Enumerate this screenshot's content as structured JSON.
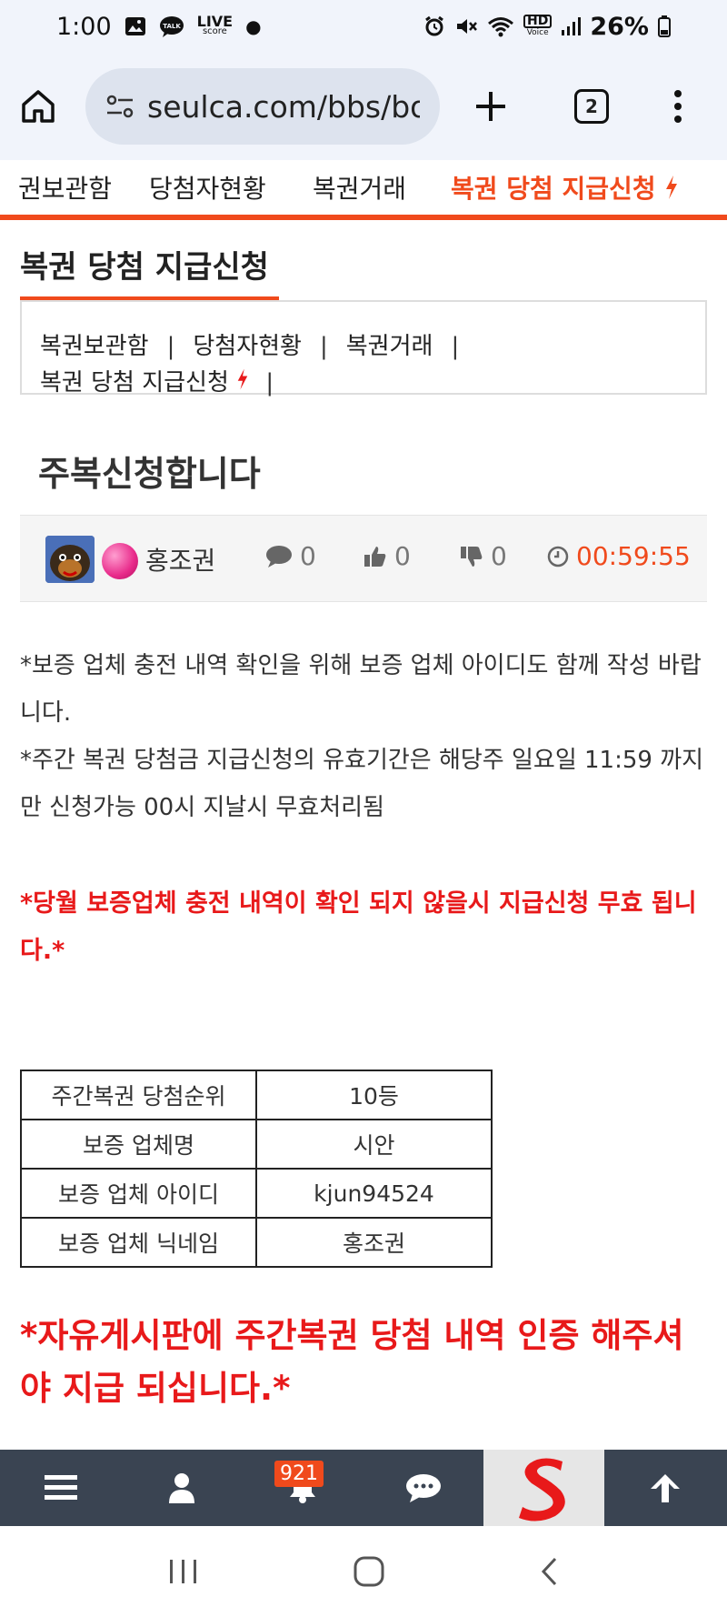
{
  "status_bar": {
    "time": "1:00",
    "live_badge_top": "LIVE",
    "live_badge_bottom": "score",
    "hd_top": "HD",
    "hd_bottom": "Voice",
    "battery": "26%"
  },
  "browser": {
    "url": "seulca.com/bbs/board.php",
    "tab_count": "2"
  },
  "site_nav": {
    "items": [
      "권보관함",
      "당첨자현황",
      "복권거래",
      "복권 당첨 지급신청"
    ]
  },
  "board": {
    "title": "복권 당첨 지급신청",
    "sub_nav": [
      "복권보관함",
      "당첨자현황",
      "복권거래",
      "복권 당첨 지급신청"
    ],
    "sep": "|"
  },
  "post": {
    "title": "주복신청합니다",
    "author": "홍조권",
    "comments": "0",
    "likes": "0",
    "dislikes": "0",
    "time": "00:59:55",
    "body_line1": "*보증 업체 충전 내역 확인을 위해 보증 업체 아이디도 함께 작성 바랍니다.",
    "body_line2": "*주간 복권 당첨금 지급신청의 유효기간은 해당주 일요일 11:59 까지만 신청가능 00시 지날시 무효처리됨",
    "red_notice": "*당월 보증업체 충전 내역이 확인 되지 않을시 지급신청 무효 됩니다.*",
    "table": [
      {
        "key": "주간복권 당첨순위",
        "value": "10등"
      },
      {
        "key": "보증 업체명",
        "value": "시안"
      },
      {
        "key": "보증 업체 아이디",
        "value": "kjun94524"
      },
      {
        "key": "보증 업체 닉네임",
        "value": "홍조권"
      }
    ],
    "big_red_notice": "*자유게시판에 주간복권 당첨 내역 인증 해주셔야 지급 되십니다.*"
  },
  "bottom_bar": {
    "notification_count": "921"
  },
  "colors": {
    "accent": "#f04a1c",
    "red": "#e8191a",
    "toolbar_bg": "#3a4452",
    "browser_bg": "#f1f4fb"
  }
}
